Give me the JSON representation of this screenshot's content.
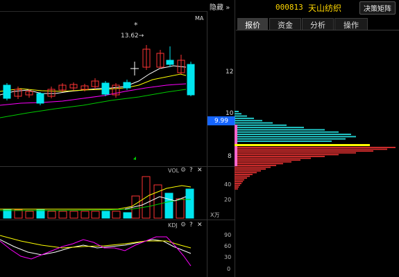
{
  "header": {
    "hide_label": "隐藏",
    "hide_icon": "double-chevron-right-icon",
    "stock_code": "000813",
    "stock_name": "天山纺织",
    "decision_button": "决策矩阵"
  },
  "tabs": [
    {
      "label": "报价",
      "active": true
    },
    {
      "label": "资金",
      "active": false
    },
    {
      "label": "分析",
      "active": false
    },
    {
      "label": "操作",
      "active": false
    }
  ],
  "main_chart": {
    "ma_label": "MA",
    "high_marker": "*",
    "high_annotation": "13.62→",
    "price_axis": [
      "12",
      "10",
      "8"
    ],
    "current_price": "9.99",
    "colors": {
      "up": "#ff3333",
      "down": "#00e5ee",
      "ma1": "#ffffff",
      "ma2": "#ffff00",
      "ma3": "#ff00ff",
      "ma4": "#00cc00"
    }
  },
  "vol_panel": {
    "title": "VOL",
    "axis": [
      "40",
      "20"
    ],
    "unit": "X万"
  },
  "kdj_panel": {
    "title": "KDJ",
    "axis": [
      "90",
      "60",
      "30",
      "0"
    ]
  },
  "icons": [
    "gear-icon",
    "question-icon",
    "close-icon"
  ]
}
